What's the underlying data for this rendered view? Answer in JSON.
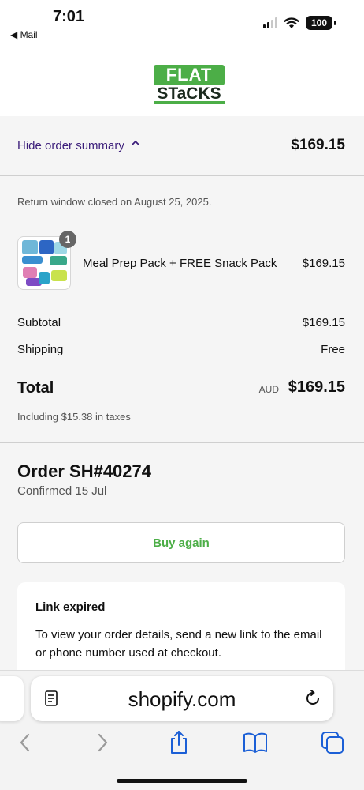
{
  "status_bar": {
    "time": "7:01",
    "back_app": "◀ Mail",
    "battery": "100"
  },
  "brand": {
    "logo_top": "FLAT",
    "logo_bottom": "STaCKS",
    "accent": "#4cae47"
  },
  "summary": {
    "toggle_label": "Hide order summary",
    "toggle_icon": "chevron-up-icon",
    "total": "$169.15"
  },
  "return_note": "Return window closed on August 25, 2025.",
  "item": {
    "quantity": "1",
    "name": "Meal Prep Pack + FREE Snack Pack",
    "price": "$169.15"
  },
  "totals": {
    "subtotal_label": "Subtotal",
    "subtotal": "$169.15",
    "shipping_label": "Shipping",
    "shipping": "Free",
    "total_label": "Total",
    "currency": "AUD",
    "total": "$169.15",
    "taxes": "Including $15.38 in taxes"
  },
  "order": {
    "title": "Order SH#40274",
    "confirmed": "Confirmed 15 Jul"
  },
  "buy_again_label": "Buy again",
  "link_card": {
    "title": "Link expired",
    "message": "To view your order details, send a new link to the email or phone number used at checkout."
  },
  "browser": {
    "url": "shopify.com"
  }
}
